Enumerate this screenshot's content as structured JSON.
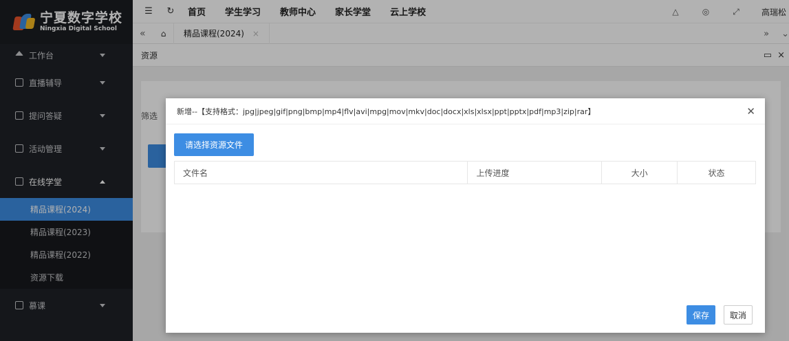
{
  "brand": {
    "name_cn": "宁夏数字学校",
    "name_en": "Ningxia Digital School"
  },
  "sidebar": {
    "items": [
      {
        "label": "工作台",
        "icon": "home-icon"
      },
      {
        "label": "直播辅导",
        "icon": "live-icon"
      },
      {
        "label": "提问答疑",
        "icon": "question-icon"
      },
      {
        "label": "活动管理",
        "icon": "activity-icon"
      },
      {
        "label": "在线学堂",
        "icon": "school-icon"
      }
    ],
    "subitems": [
      {
        "label": "精品课程(2024)",
        "active": true
      },
      {
        "label": "精品课程(2023)",
        "active": false
      },
      {
        "label": "精品课程(2022)",
        "active": false
      },
      {
        "label": "资源下载",
        "active": false
      }
    ],
    "last_item": {
      "label": "慕课",
      "icon": "mooc-icon"
    }
  },
  "topnav": {
    "links": [
      "首页",
      "学生学习",
      "教师中心",
      "家长学堂",
      "云上学校"
    ],
    "user": "高瑞松"
  },
  "tabs": [
    {
      "label": "精品课程(2024)"
    }
  ],
  "content": {
    "header": "资源",
    "filter_label": "筛选"
  },
  "modal": {
    "title": "新增--【支持格式：jpg|jpeg|gif|png|bmp|mp4|flv|avi|mpg|mov|mkv|doc|docx|xls|xlsx|ppt|pptx|pdf|mp3|zip|rar】",
    "upload_label": "请选择资源文件",
    "columns": [
      "文件名",
      "上传进度",
      "大小",
      "状态"
    ],
    "save_label": "保存",
    "cancel_label": "取消"
  },
  "colors": {
    "accent": "#3d8de3",
    "sidebar_bg": "#1f2228"
  }
}
